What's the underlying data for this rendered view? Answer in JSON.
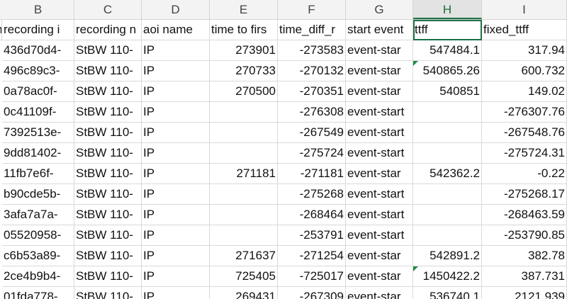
{
  "columns": [
    "B",
    "C",
    "D",
    "E",
    "F",
    "G",
    "H",
    "I"
  ],
  "selected_column": "H",
  "header_row": {
    "a": "n",
    "b": "recording i",
    "c": "recording n",
    "d": "aoi name",
    "e": "time to firs",
    "f": "time_diff_r",
    "g": "start event",
    "h": "ttff",
    "i": "fixed_ttff"
  },
  "rows": [
    {
      "b": "436d70d4-",
      "c": "StBW 110-",
      "d": "IP",
      "e": "273901",
      "f": "-273583",
      "g": "event-star",
      "h": "547484.1",
      "i": "317.94",
      "tri": false
    },
    {
      "b": "496c89c3-",
      "c": "StBW 110-",
      "d": "IP",
      "e": "270733",
      "f": "-270132",
      "g": "event-star",
      "h": "540865.26",
      "i": "600.732",
      "tri": true
    },
    {
      "b": "0a78ac0f-",
      "c": "StBW 110-",
      "d": "IP",
      "e": "270500",
      "f": "-270351",
      "g": "event-star",
      "h": "540851",
      "i": "149.02",
      "tri": false
    },
    {
      "b": "0c41109f-",
      "c": "StBW 110-",
      "d": "IP",
      "e": "",
      "f": "-276308",
      "g": "event-start",
      "h": "",
      "i": "-276307.76",
      "tri": false
    },
    {
      "b": "7392513e-",
      "c": "StBW 110-",
      "d": "IP",
      "e": "",
      "f": "-267549",
      "g": "event-start",
      "h": "",
      "i": "-267548.76",
      "tri": false
    },
    {
      "b": "9dd81402-",
      "c": "StBW 110-",
      "d": "IP",
      "e": "",
      "f": "-275724",
      "g": "event-start",
      "h": "",
      "i": "-275724.31",
      "tri": false
    },
    {
      "b": "11fb7e6f-",
      "c": "StBW 110-",
      "d": "IP",
      "e": "271181",
      "f": "-271181",
      "g": "event-star",
      "h": "542362.2",
      "i": "-0.22",
      "tri": false
    },
    {
      "b": "b90cde5b-",
      "c": "StBW 110-",
      "d": "IP",
      "e": "",
      "f": "-275268",
      "g": "event-start",
      "h": "",
      "i": "-275268.17",
      "tri": false
    },
    {
      "b": "3afa7a7a-",
      "c": "StBW 110-",
      "d": "IP",
      "e": "",
      "f": "-268464",
      "g": "event-start",
      "h": "",
      "i": "-268463.59",
      "tri": false
    },
    {
      "b": "05520958-",
      "c": "StBW 110-",
      "d": "IP",
      "e": "",
      "f": "-253791",
      "g": "event-start",
      "h": "",
      "i": "-253790.85",
      "tri": false
    },
    {
      "b": "c6b53a89-",
      "c": "StBW 110-",
      "d": "IP",
      "e": "271637",
      "f": "-271254",
      "g": "event-star",
      "h": "542891.2",
      "i": "382.78",
      "tri": false
    },
    {
      "b": "2ce4b9b4-",
      "c": "StBW 110-",
      "d": "IP",
      "e": "725405",
      "f": "-725017",
      "g": "event-star",
      "h": "1450422.2",
      "i": "387.731",
      "tri": true
    },
    {
      "b": "01fda778-",
      "c": "StBW 110-",
      "d": "IP",
      "e": "269431",
      "f": "-267309",
      "g": "event-star",
      "h": "536740.1",
      "i": "2121.939",
      "tri": false
    }
  ],
  "colors": {
    "accent": "#1e7145",
    "header_bg": "#f3f3f3",
    "gridline": "#d9d9d9",
    "note_triangle": "#1e8e3e"
  }
}
